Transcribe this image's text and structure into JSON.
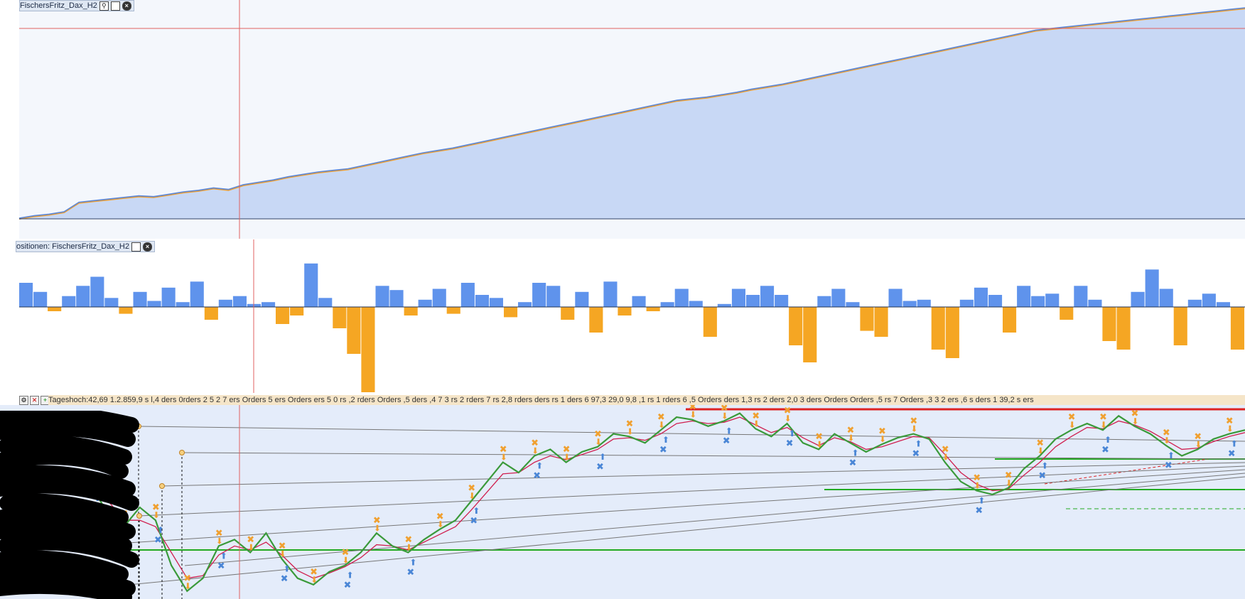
{
  "equity_panel": {
    "title": "FischersFritz_Dax_H2"
  },
  "positions_panel": {
    "title": "ositionen: FischersFritz_Dax_H2"
  },
  "price_panel": {
    "readout": "Tageshoch:42,69 1.2.859,9 s l,4 ders 0rders 2 5 2 7 ers Orders 5 ers Orders ers 5 0 rs ,2 rders Orders ,5 ders ,4 7 3 rs 2 rders 7 rs 2,8 rders ders rs 1 ders 6 97,3 29,0 9,8 ,1 rs 1 rders 6 ,5 Orders ders 1,3 rs 2 ders 2,0 3 ders Orders Orders ,5 rs 7 Orders ,3 3 2 ers ,6 s ders 1 39,2 s ers"
  },
  "icons": [
    "maximize-icon",
    "close-icon",
    "settings-icon",
    "add-icon",
    "delete-icon"
  ],
  "colors": {
    "equity_fill": "#c8d8f5",
    "equity_line": "#5b87d8",
    "equity_accent": "#f0a030",
    "positive_bar": "#5f93ec",
    "negative_bar": "#f5a623",
    "crosshair": "#e06060",
    "price_line": "#3a9a3a",
    "ma_line": "#d02050",
    "buy_marker": "#4a86d6",
    "sell_marker": "#f0a030",
    "support_line": "#22aa22",
    "resistance_line": "#dd2222",
    "price_bg": "#e4ecfa"
  },
  "chart_data": [
    {
      "type": "area",
      "series": [
        {
          "values": [
            0,
            3,
            5,
            8,
            20,
            22,
            24,
            26,
            28,
            27,
            30,
            33,
            35,
            38,
            36,
            42,
            45,
            48,
            52,
            55,
            58,
            60,
            62,
            66,
            70,
            74,
            78,
            82,
            85,
            88,
            92,
            96,
            100,
            104,
            108,
            112,
            116,
            120,
            124,
            128,
            132,
            136,
            140,
            144,
            148,
            150,
            152,
            155,
            158,
            162,
            165,
            168,
            172,
            176,
            180,
            184,
            188,
            192,
            196,
            200,
            204,
            208,
            212,
            216,
            220,
            224,
            228,
            232,
            236,
            238,
            240,
            242,
            244,
            246,
            248,
            250,
            252,
            254,
            256,
            258,
            260,
            262,
            264
          ]
        }
      ],
      "grid": false
    },
    {
      "type": "bar",
      "series": [
        {
          "values": [
            40,
            25,
            -5,
            18,
            35,
            50,
            15,
            -8,
            25,
            10,
            32,
            8,
            42,
            -15,
            12,
            18,
            5,
            8,
            -20,
            -10,
            72,
            15,
            -25,
            -55,
            -100,
            35,
            28,
            -10,
            12,
            30,
            -8,
            40,
            20,
            15,
            -12,
            8,
            40,
            35,
            -15,
            25,
            -30,
            42,
            -10,
            18,
            -5,
            8,
            30,
            10,
            -35,
            5,
            30,
            20,
            35,
            20,
            -45,
            -65,
            18,
            30,
            8,
            -28,
            -35,
            30,
            10,
            12,
            -50,
            -60,
            12,
            32,
            20,
            -30,
            35,
            18,
            22,
            -15,
            35,
            12,
            -40,
            -50,
            25,
            62,
            30,
            -45,
            12,
            22,
            8,
            -50
          ]
        }
      ],
      "grid": false
    },
    {
      "type": "line",
      "series": [
        {
          "values": [
            11400,
            11200,
            11100,
            11250,
            11150,
            10800,
            10600,
            10700,
            10950,
            11000,
            10900,
            11050,
            10850,
            10700,
            10650,
            10750,
            10800,
            10900,
            11050,
            10950,
            10900,
            11000,
            11080,
            11150,
            11300,
            11450,
            11600,
            11520,
            11650,
            11700,
            11600,
            11680,
            11720,
            11820,
            11800,
            11750,
            11850,
            11950,
            11930,
            11880,
            11920,
            11980,
            11860,
            11800,
            11900,
            11750,
            11700,
            11820,
            11750,
            11680,
            11740,
            11790,
            11820,
            11780,
            11600,
            11450,
            11380,
            11350,
            11400,
            11550,
            11650,
            11780,
            11850,
            11900,
            11850,
            11960,
            11880,
            11820,
            11730,
            11650,
            11700,
            11780,
            11820,
            11850
          ]
        },
        {
          "values": [
            11500,
            11300,
            11150,
            11150,
            11100,
            10900,
            10700,
            10720,
            10880,
            10950,
            10920,
            10980,
            10880,
            10760,
            10700,
            10740,
            10790,
            10860,
            10960,
            10950,
            10920,
            10980,
            11040,
            11100,
            11230,
            11370,
            11510,
            11520,
            11600,
            11650,
            11620,
            11660,
            11700,
            11780,
            11790,
            11770,
            11820,
            11900,
            11920,
            11900,
            11910,
            11950,
            11890,
            11830,
            11870,
            11790,
            11730,
            11790,
            11760,
            11700,
            11720,
            11760,
            11800,
            11790,
            11660,
            11520,
            11430,
            11380,
            11390,
            11500,
            11600,
            11720,
            11800,
            11870,
            11860,
            11920,
            11890,
            11840,
            11770,
            11700,
            11710,
            11760,
            11800,
            11830
          ]
        }
      ],
      "grid": false
    }
  ]
}
